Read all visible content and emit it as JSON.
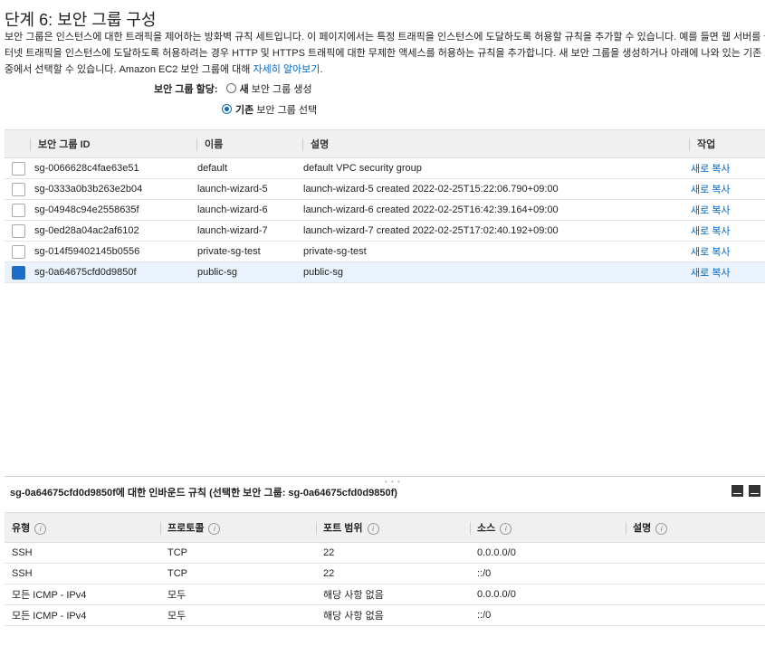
{
  "page": {
    "title": "단계 6: 보안 그룹 구성",
    "desc_line1": "보안 그룹은 인스턴스에 대한 트래픽을 제어하는 방화벽 규칙 세트입니다. 이 페이지에서는 특정 트래픽을 인스턴스에 도달하도록 허용할 규칙을 추가할 수 있습니다. 예를 들면 웹 서버를 설정하여",
    "desc_line2": "터넷 트래픽을 인스턴스에 도달하도록 허용하려는 경우 HTTP 및 HTTPS 트래픽에 대한 무제한 액세스를 허용하는 규칙을 추가합니다. 새 보안 그룹을 생성하거나 아래에 나와 있는 기존 보안 그",
    "desc_line3_prefix": "중에서 선택할 수 있습니다. Amazon EC2 보안 그룹에 대해 ",
    "desc_link": "자세히 알아보기",
    "desc_line3_suffix": "."
  },
  "assign": {
    "label": "보안 그룹 할당:",
    "new_bold": "새",
    "new_rest": " 보안 그룹 생성",
    "existing_bold": "기존",
    "existing_rest": " 보안 그룹 선택"
  },
  "sg_table": {
    "headers": [
      "보안 그룹 ID",
      "이름",
      "설명",
      "작업"
    ],
    "rows": [
      {
        "id": "sg-0066628c4fae63e51",
        "name": "default",
        "desc": "default VPC security group",
        "action": "새로 복사",
        "selected": false
      },
      {
        "id": "sg-0333a0b3b263e2b04",
        "name": "launch-wizard-5",
        "desc": "launch-wizard-5 created 2022-02-25T15:22:06.790+09:00",
        "action": "새로 복사",
        "selected": false
      },
      {
        "id": "sg-04948c94e2558635f",
        "name": "launch-wizard-6",
        "desc": "launch-wizard-6 created 2022-02-25T16:42:39.164+09:00",
        "action": "새로 복사",
        "selected": false
      },
      {
        "id": "sg-0ed28a04ac2af6102",
        "name": "launch-wizard-7",
        "desc": "launch-wizard-7 created 2022-02-25T17:02:40.192+09:00",
        "action": "새로 복사",
        "selected": false
      },
      {
        "id": "sg-014f59402145b0556",
        "name": "private-sg-test",
        "desc": "private-sg-test",
        "action": "새로 복사",
        "selected": false
      },
      {
        "id": "sg-0a64675cfd0d9850f",
        "name": "public-sg",
        "desc": "public-sg",
        "action": "새로 복사",
        "selected": true
      }
    ]
  },
  "inbound": {
    "title": "sg-0a64675cfd0d9850f에 대한 인바운드 규칙 (선택한 보안 그룹: sg-0a64675cfd0d9850f)",
    "headers": [
      "유형",
      "프로토콜",
      "포트 범위",
      "소스",
      "설명"
    ],
    "info_glyph": "i",
    "rows": [
      [
        "SSH",
        "TCP",
        "22",
        "0.0.0.0/0",
        ""
      ],
      [
        "SSH",
        "TCP",
        "22",
        "::/0",
        ""
      ],
      [
        "모든 ICMP - IPv4",
        "모두",
        "해당 사항 없음",
        "0.0.0.0/0",
        ""
      ],
      [
        "모든 ICMP - IPv4",
        "모두",
        "해당 사항 없음",
        "::/0",
        ""
      ]
    ]
  },
  "colors": {
    "link": "#0066c0",
    "selected_row": "#eaf3fd",
    "checkbox_on": "#1a6dc9"
  }
}
